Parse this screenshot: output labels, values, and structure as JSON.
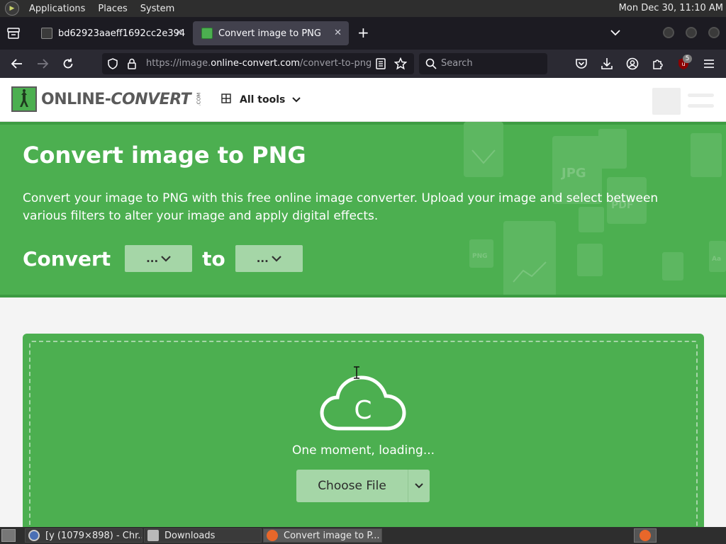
{
  "os_panel": {
    "menus": [
      "Applications",
      "Places",
      "System"
    ],
    "clock": "Mon Dec 30, 11:10 AM"
  },
  "browser": {
    "tabs": [
      {
        "title": "bd62923aaeff1692cc2e394",
        "active": false
      },
      {
        "title": "Convert image to PNG",
        "active": true
      }
    ],
    "url_prefix": "https://image.",
    "url_host": "online-convert.com",
    "url_path": "/convert-to-png",
    "search_placeholder": "Search",
    "extension_badge": "5"
  },
  "site": {
    "logo_text_1": "ONLINE-",
    "logo_text_2": "CONVERT",
    "logo_com": ".COM",
    "all_tools_label": "All tools"
  },
  "hero": {
    "title": "Convert image to PNG",
    "description": "Convert your image to PNG with this free online image converter. Upload your image and select between various filters to alter your image and apply digital effects.",
    "convert_label": "Convert",
    "to_label": "to",
    "from_select": "...",
    "to_select": "..."
  },
  "upload": {
    "cloud_letter": "C",
    "loading_text": "One moment, loading...",
    "choose_file_label": "Choose File"
  },
  "taskbar": {
    "items": [
      "[y (1079×898) - Chr...",
      "Downloads",
      "Convert image to P..."
    ]
  },
  "colors": {
    "brand_green": "#4caf50",
    "light_green": "#a5d6a7"
  }
}
